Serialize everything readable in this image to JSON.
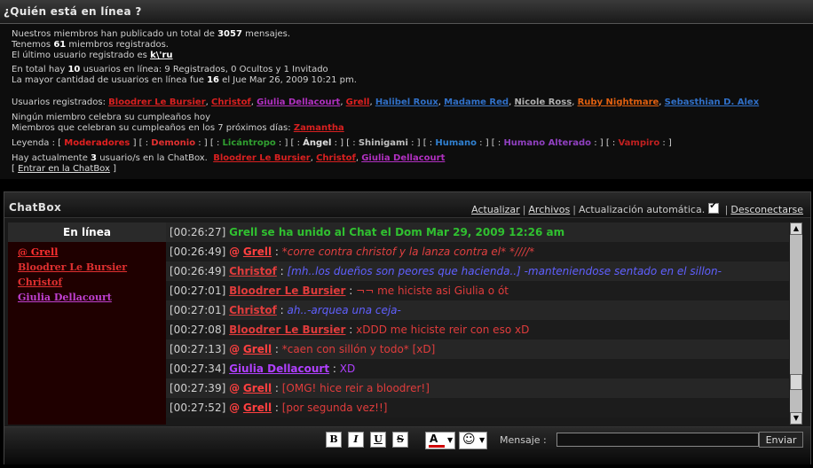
{
  "header": {
    "title": "¿Quién está en línea ?"
  },
  "info": {
    "posts_pre": "Nuestros miembros han publicado un total de",
    "posts_count": "3057",
    "posts_post": "mensajes.",
    "members_pre": "Tenemos",
    "members_count": "61",
    "members_post": "miembros registrados.",
    "last_user_pre": "El último usuario registrado es",
    "last_user": "k\\'ru",
    "online_pre": "En total hay",
    "online_count": "10",
    "online_post": "usuarios en línea: 9 Registrados, 0 Ocultos y 1 Invitado",
    "record_pre": "La mayor cantidad de usuarios en línea fue",
    "record_count": "16",
    "record_post": "el Jue Mar 26, 2009 10:21 pm.",
    "registered_label": "Usuarios registrados:",
    "registered_users": [
      {
        "name": "Bloodrer Le Bursier",
        "color": "#d82020"
      },
      {
        "name": "Christof",
        "color": "#d82020"
      },
      {
        "name": "Giulia Dellacourt",
        "color": "#b030c0"
      },
      {
        "name": "Grell",
        "color": "#e02020"
      },
      {
        "name": "Halibel Roux",
        "color": "#3070c8"
      },
      {
        "name": "Madame Red",
        "color": "#3070c8"
      },
      {
        "name": "Nicole Ross",
        "color": "#b0b0b0"
      },
      {
        "name": "Ruby Nightmare",
        "color": "#e06010"
      },
      {
        "name": "Sebasthian D. Alex",
        "color": "#3070c8"
      }
    ],
    "birthday_today": "Ningún miembro celebra su cumpleaños hoy",
    "birthday_next_pre": "Miembros que celebran su cumpleaños en los 7 próximos días:",
    "birthday_next_user": "Zamantha",
    "legend_label": "Leyenda :",
    "legend": [
      "Moderadores",
      "Demonio",
      "Licántropo",
      "Ángel",
      "Shinigami",
      "Humano",
      "Humano Alterado",
      "Vampiro"
    ],
    "chatbox_pre": "Hay actualmente",
    "chatbox_count": "3",
    "chatbox_post": "usuario/s en la ChatBox.",
    "chatbox_users": [
      "Bloodrer Le Bursier",
      "Christof",
      "Giulia Dellacourt"
    ],
    "enter_chat": "Entrar en la ChatBox"
  },
  "chatbox": {
    "title": "ChatBox",
    "refresh": "Actualizar",
    "archives": "Archivos",
    "auto_refresh": "Actualización automática.",
    "auto_refresh_checked": true,
    "disconnect": "Desconectarse",
    "online_header": "En línea",
    "online_users": [
      {
        "name": "@ Grell",
        "color": "#ff3030"
      },
      {
        "name": "Bloodrer Le Bursier",
        "color": "#e03030"
      },
      {
        "name": "Christof",
        "color": "#e03030"
      },
      {
        "name": "Giulia Dellacourt",
        "color": "#c040d0"
      }
    ],
    "messages": [
      {
        "time": "[00:26:27]",
        "join": "Grell se ha unido al Chat el Dom Mar 29, 2009 12:26 am"
      },
      {
        "time": "[00:26:49]",
        "at": "@",
        "user": "Grell",
        "user_color": "#ff4040",
        "text": "*corre contra christof y la lanza contra el* *////*",
        "text_class": "t-red"
      },
      {
        "time": "[00:26:49]",
        "user": "Christof",
        "user_color": "#e03c3c",
        "text": "[mh..los dueños son peores que hacienda..] -manteniendose sentado en el sillon-",
        "text_class": "t-blue"
      },
      {
        "time": "[00:27:01]",
        "user": "Bloodrer Le Bursier",
        "user_color": "#e03c3c",
        "text": "¬¬ me hiciste asi Giulia o ót",
        "text_class": "t-red2"
      },
      {
        "time": "[00:27:01]",
        "user": "Christof",
        "user_color": "#e03c3c",
        "text": "ah..-arquea una ceja-",
        "text_class": "t-blue"
      },
      {
        "time": "[00:27:08]",
        "user": "Bloodrer Le Bursier",
        "user_color": "#e03c3c",
        "text": "xDDD me hiciste reir con eso xD",
        "text_class": "t-red2"
      },
      {
        "time": "[00:27:13]",
        "at": "@",
        "user": "Grell",
        "user_color": "#ff4040",
        "text": "*caen con sillón y todo* [xD]",
        "text_class": "t-red2"
      },
      {
        "time": "[00:27:34]",
        "user": "Giulia Dellacourt",
        "user_color": "#b040ff",
        "text": "XD",
        "text_class": "t-purple"
      },
      {
        "time": "[00:27:39]",
        "at": "@",
        "user": "Grell",
        "user_color": "#ff4040",
        "text": "[OMG! hice reir a bloodrer!]",
        "text_class": "t-red2"
      },
      {
        "time": "[00:27:52]",
        "at": "@",
        "user": "Grell",
        "user_color": "#ff4040",
        "text": "[por segunda vez!!]",
        "text_class": "t-red2"
      }
    ],
    "toolbar": {
      "bold": "B",
      "italic": "I",
      "underline": "U",
      "strike": "S",
      "color_glyph": "A",
      "color_value": "#d00000",
      "smiley_glyph": "☺",
      "message_label": "Mensaje :",
      "message_value": "",
      "send": "Enviar"
    }
  }
}
